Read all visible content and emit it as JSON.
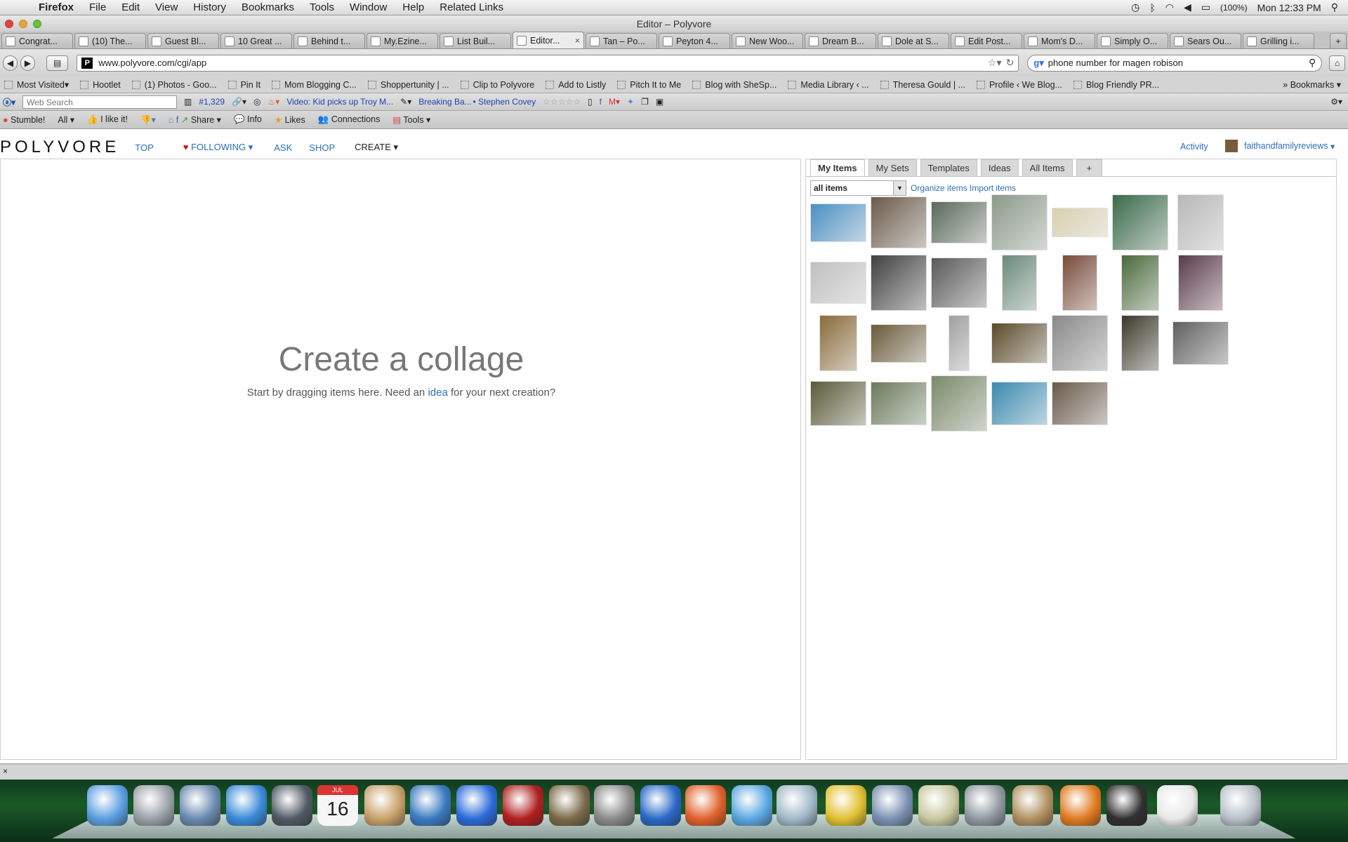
{
  "menubar": {
    "app": "Firefox",
    "items": [
      "File",
      "Edit",
      "View",
      "History",
      "Bookmarks",
      "Tools",
      "Window",
      "Help",
      "Related Links"
    ],
    "battery": "(100%)",
    "clock": "Mon 12:33 PM"
  },
  "window": {
    "title": "Editor – Polyvore"
  },
  "tabs": [
    {
      "label": "Congrat...",
      "icon": "mail-icon",
      "active": false
    },
    {
      "label": "(10) The...",
      "icon": "google-plus-icon",
      "active": false
    },
    {
      "label": "Guest Bl...",
      "icon": "page-icon",
      "active": false
    },
    {
      "label": "10 Great ...",
      "icon": "page-icon",
      "active": false
    },
    {
      "label": "Behind t...",
      "icon": "wordpress-icon",
      "active": false
    },
    {
      "label": "My.Ezine...",
      "icon": "at-icon",
      "active": false
    },
    {
      "label": "List Buil...",
      "icon": "page-icon",
      "active": false
    },
    {
      "label": "Editor...",
      "icon": "polyvore-icon",
      "active": true
    },
    {
      "label": "Tan – Po...",
      "icon": "polyvore-icon",
      "active": false
    },
    {
      "label": "Peyton 4...",
      "icon": "polyvore-icon",
      "active": false
    },
    {
      "label": "New Woo...",
      "icon": "sears-icon",
      "active": false
    },
    {
      "label": "Dream B...",
      "icon": "dream-icon",
      "active": false
    },
    {
      "label": "Dole at S...",
      "icon": "page-icon",
      "active": false
    },
    {
      "label": "Edit Post...",
      "icon": "page-icon",
      "active": false
    },
    {
      "label": "Mom's D...",
      "icon": "page-icon",
      "active": false
    },
    {
      "label": "Simply O...",
      "icon": "cloud-icon",
      "active": false
    },
    {
      "label": "Sears Ou...",
      "icon": "sears-icon",
      "active": false
    },
    {
      "label": "Grilling i...",
      "icon": "sears-icon",
      "active": false
    }
  ],
  "nav": {
    "url": "www.polyvore.com/cgi/app",
    "search": "phone number for magen robison"
  },
  "bookmarks": [
    "Most Visited",
    "Hootlet",
    "(1) Photos - Goo...",
    "Pin It",
    "Mom Blogging C...",
    "Shoppertunity | ...",
    "Clip to Polyvore",
    "Add to Listly",
    "Pitch It to Me",
    "Blog with SheSp...",
    "Media Library ‹ ...",
    "Theresa Gould | ...",
    "Profile ‹ We Blog...",
    "Blog Friendly PR..."
  ],
  "bookmarks_menu": "Bookmarks",
  "toolbar2": {
    "search_placeholder": "Web Search",
    "rank": "#1,329",
    "video": "Video: Kid picks up Troy M...",
    "breaking": "Breaking Ba...",
    "covey": "• Stephen Covey"
  },
  "toolbar3": {
    "stumble": "Stumble!",
    "all": "All",
    "ilike": "I like it!",
    "share": "Share",
    "info": "Info",
    "likes": "Likes",
    "connections": "Connections",
    "tools": "Tools"
  },
  "site": {
    "logo": "POLYVORE",
    "nav": [
      "TOP",
      "FOLLOWING",
      "ASK",
      "SHOP",
      "CREATE"
    ],
    "activity": "Activity",
    "user": "faithandfamilyreviews"
  },
  "canvas": {
    "headline": "Create a collage",
    "sub_before": "Start by dragging items here. Need an ",
    "sub_link": "idea",
    "sub_after": " for your next creation?"
  },
  "panel": {
    "tabs": [
      "My Items",
      "My Sets",
      "Templates",
      "Ideas",
      "All Items",
      "+"
    ],
    "filter": "all items",
    "organize": "Organize items",
    "import": "Import items"
  },
  "items": [
    {
      "name": "hammock-beach",
      "color": "#4a8fc4"
    },
    {
      "name": "patio-lounge-chair",
      "color": "#6a5a4a"
    },
    {
      "name": "patio-set-pool",
      "color": "#5a6a5a"
    },
    {
      "name": "lantern",
      "color": "#8a9a8a"
    },
    {
      "name": "string-lights",
      "color": "#d8d0b0"
    },
    {
      "name": "hummingbird-lights",
      "color": "#3a6a4a"
    },
    {
      "name": "turkey-fryer",
      "color": "#b8b8b8"
    },
    {
      "name": "grill-basket",
      "color": "#c0c0c0"
    },
    {
      "name": "bbq-tool-case",
      "color": "#404040"
    },
    {
      "name": "bbq-tool-set",
      "color": "#5a5a5a"
    },
    {
      "name": "garden-sign",
      "color": "#6a8a7a"
    },
    {
      "name": "door-figure",
      "color": "#7a4a3a"
    },
    {
      "name": "garden-arbor",
      "color": "#4a6a3a"
    },
    {
      "name": "butterfly-lights",
      "color": "#5a3a4a"
    },
    {
      "name": "plant-stand",
      "color": "#8a6a3a"
    },
    {
      "name": "wagon-planter",
      "color": "#6a5a3a"
    },
    {
      "name": "tiered-planter",
      "color": "#a0a0a0"
    },
    {
      "name": "grill-cover",
      "color": "#5a4a2a"
    },
    {
      "name": "gas-grill",
      "color": "#8a8a8a"
    },
    {
      "name": "rock-fountain",
      "color": "#3a3a2a"
    },
    {
      "name": "fire-pit",
      "color": "#606060"
    },
    {
      "name": "ottoman",
      "color": "#5a5a3a"
    },
    {
      "name": "umbrella-patio-set",
      "color": "#6a7a5a"
    },
    {
      "name": "recliner",
      "color": "#7a8a6a"
    },
    {
      "name": "pool",
      "color": "#3a8ab0"
    },
    {
      "name": "gazebo",
      "color": "#6a5a4a"
    }
  ],
  "dock": [
    "finder",
    "launchpad",
    "mail",
    "safari",
    "facetime",
    "calendar",
    "address-book",
    "web",
    "itunes",
    "photo-booth",
    "iphoto",
    "system-prefs",
    "word",
    "powerpoint",
    "messenger",
    "network",
    "chrome",
    "preview",
    "archive",
    "hp",
    "chess",
    "firefox",
    "printer",
    "docs",
    "trash"
  ],
  "dock_calendar": {
    "month": "JUL",
    "day": "16"
  }
}
